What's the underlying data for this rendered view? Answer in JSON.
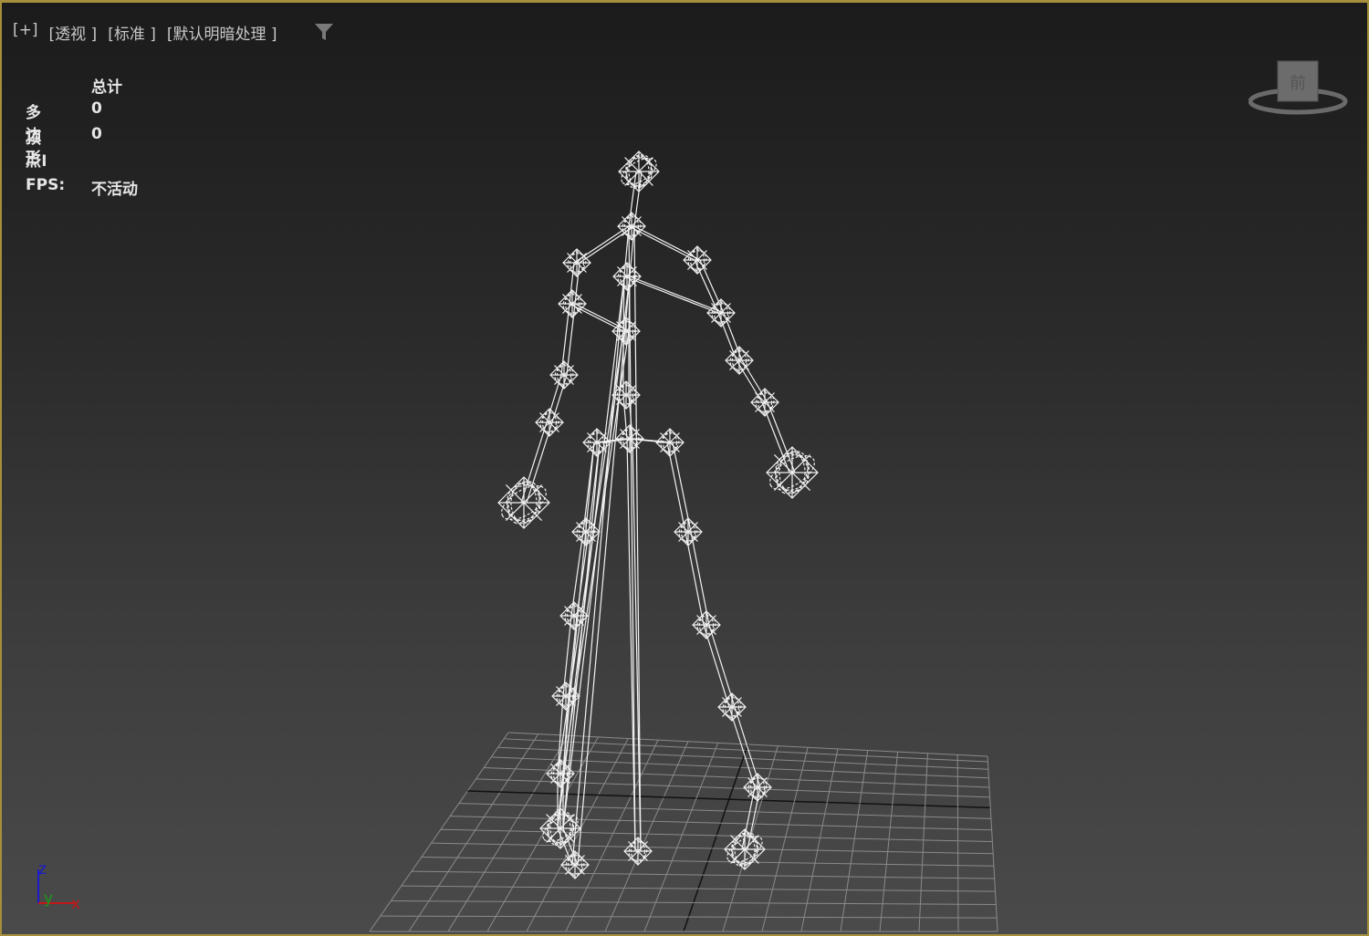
{
  "viewport_menu": {
    "plus": "[+]",
    "view": "[透视 ]",
    "mode": "[标准 ]",
    "shading": "[默认明暗处理 ]"
  },
  "stats": {
    "header": "总计",
    "polygons_label": "多边形:",
    "polygons_value": "0",
    "vertices_label": "顶点:",
    "vertices_value": "0",
    "fps_label": "FPS:",
    "fps_value": "不活动"
  },
  "viewcube": {
    "face_label": "前"
  },
  "axis": {
    "z": "z",
    "y": "y",
    "x": "x"
  },
  "colors": {
    "border": "#a68f3c",
    "x_axis": "#c01818",
    "y_axis": "#1a9a1a",
    "z_axis": "#1a1ad0"
  }
}
